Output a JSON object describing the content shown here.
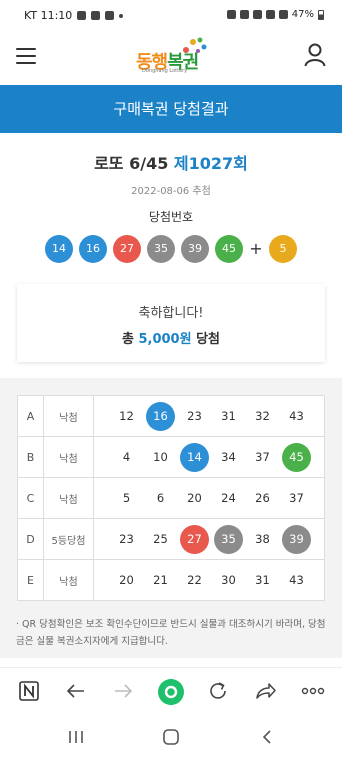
{
  "status_bar": {
    "carrier_time": "KT 11:10",
    "battery": "47%"
  },
  "header": {
    "logo_text_1": "동행",
    "logo_text_2": "복권",
    "logo_sub": "Donghang Lottery"
  },
  "page_title": "구매복권 당첨결과",
  "result": {
    "game_name": "로또 6/45",
    "round": "제1027회",
    "draw_date": "2022-08-06 추첨",
    "winning_label": "당첨번호",
    "winning_numbers": [
      "14",
      "16",
      "27",
      "35",
      "39",
      "45"
    ],
    "plus": "+",
    "bonus_number": "5"
  },
  "congrats": {
    "line1": "축하합니다!",
    "line2_prefix": "총 ",
    "amount": "5,000원",
    "line2_suffix": " 당첨"
  },
  "ticket_rows": [
    {
      "label": "A",
      "result": "낙첨",
      "numbers": [
        "12",
        "16",
        "23",
        "31",
        "32",
        "43"
      ],
      "colors": [
        "",
        "blue",
        "",
        "",
        "",
        ""
      ]
    },
    {
      "label": "B",
      "result": "낙첨",
      "numbers": [
        "4",
        "10",
        "14",
        "34",
        "37",
        "45"
      ],
      "colors": [
        "",
        "",
        "blue",
        "",
        "",
        "green"
      ]
    },
    {
      "label": "C",
      "result": "낙첨",
      "numbers": [
        "5",
        "6",
        "20",
        "24",
        "26",
        "37"
      ],
      "colors": [
        "",
        "",
        "",
        "",
        "",
        ""
      ]
    },
    {
      "label": "D",
      "result": "5등당첨",
      "numbers": [
        "23",
        "25",
        "27",
        "35",
        "38",
        "39"
      ],
      "colors": [
        "",
        "",
        "red",
        "gray",
        "",
        "gray"
      ]
    },
    {
      "label": "E",
      "result": "낙첨",
      "numbers": [
        "20",
        "21",
        "22",
        "30",
        "31",
        "43"
      ],
      "colors": [
        "",
        "",
        "",
        "",
        "",
        ""
      ]
    }
  ],
  "notice": "· QR 당첨확인은 보조 확인수단이므로 반드시 실물과 대조하시기 바라며, 당첨금은 실물 복권소지자에게 지급합니다.",
  "ball_colors": {
    "yellow": "#e8a91c",
    "blue": "#2d8fd6",
    "red": "#e8584c",
    "gray": "#8b8b8b",
    "green": "#4ab04a"
  },
  "icons": {
    "browser": [
      "n-app-icon",
      "back-arrow-icon",
      "forward-arrow-icon",
      "home-icon",
      "refresh-icon",
      "share-icon",
      "more-icon"
    ],
    "system": [
      "recent-apps-icon",
      "home-nav-icon",
      "back-nav-icon"
    ]
  }
}
